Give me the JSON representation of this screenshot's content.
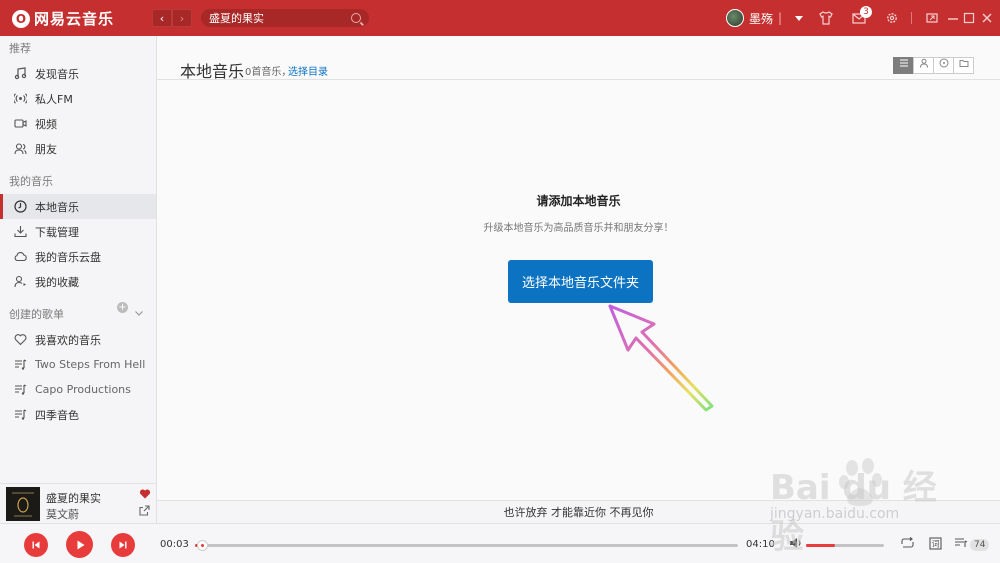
{
  "app": {
    "logo_text": "网易云音乐",
    "logo_glyph": "O",
    "accent": "#c62f2f"
  },
  "topbar": {
    "back_label": "‹",
    "forward_label": "›",
    "search_value": "盛夏的果实",
    "username": "墨殇",
    "user_sep": "|",
    "mail_badge": "3"
  },
  "sidebar": {
    "section_recommend": "推荐",
    "recommend_items": [
      {
        "label": "发现音乐",
        "icon": "music-note-icon"
      },
      {
        "label": "私人FM",
        "icon": "radio-icon"
      },
      {
        "label": "视频",
        "icon": "video-icon"
      },
      {
        "label": "朋友",
        "icon": "friends-icon"
      }
    ],
    "section_my_music": "我的音乐",
    "my_music_items": [
      {
        "label": "本地音乐",
        "icon": "local-music-icon",
        "active": true
      },
      {
        "label": "下载管理",
        "icon": "download-icon"
      },
      {
        "label": "我的音乐云盘",
        "icon": "cloud-icon"
      },
      {
        "label": "我的收藏",
        "icon": "favorites-icon"
      }
    ],
    "section_created": "创建的歌单",
    "playlist_items": [
      {
        "label": "我喜欢的音乐",
        "icon": "heart-outline-icon"
      },
      {
        "label": "Two Steps From Hell",
        "icon": "playlist-icon"
      },
      {
        "label": "Capo Productions",
        "icon": "playlist-icon"
      },
      {
        "label": "四季音色",
        "icon": "playlist-icon"
      }
    ]
  },
  "now_playing": {
    "title": "盛夏的果实",
    "artist": "莫文蔚"
  },
  "main": {
    "title": "本地音乐",
    "song_count": "0首音乐，",
    "select_dir": "选择目录",
    "empty_title": "请添加本地音乐",
    "empty_sub": "升级本地音乐为高品质音乐并和朋友分享！",
    "choose_button": "选择本地音乐文件夹"
  },
  "lyric": "也许放弃 才能靠近你 不再见你",
  "player": {
    "current_time": "00:03",
    "total_time": "04:10",
    "progress_fraction": 0.012,
    "volume_fraction": 0.37,
    "playlist_count": "74"
  },
  "watermark": {
    "logo": "Bai du 经验",
    "url": "jingyan.baidu.com"
  }
}
